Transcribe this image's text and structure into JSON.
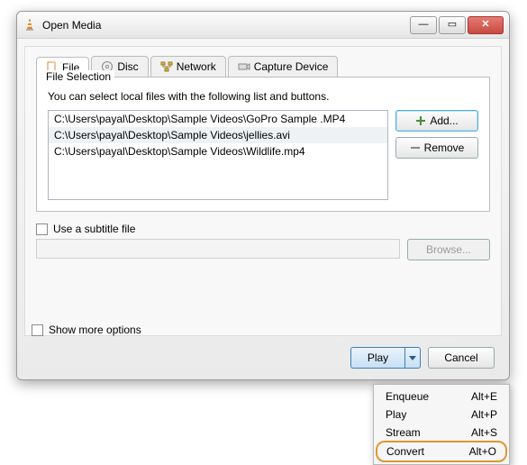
{
  "window": {
    "title": "Open Media"
  },
  "tabs": {
    "file": "File",
    "disc": "Disc",
    "network": "Network",
    "capture": "Capture Device"
  },
  "fileSelection": {
    "legend": "File Selection",
    "hint": "You can select local files with the following list and buttons.",
    "files": [
      "C:\\Users\\payal\\Desktop\\Sample Videos\\GoPro Sample .MP4",
      "C:\\Users\\payal\\Desktop\\Sample Videos\\jellies.avi",
      "C:\\Users\\payal\\Desktop\\Sample Videos\\Wildlife.mp4"
    ],
    "add": "Add...",
    "remove": "Remove"
  },
  "subtitle": {
    "label": "Use a subtitle file",
    "browse": "Browse..."
  },
  "more": "Show more options",
  "footer": {
    "play": "Play",
    "cancel": "Cancel"
  },
  "menu": {
    "items": [
      {
        "label": "Enqueue",
        "shortcut": "Alt+E"
      },
      {
        "label": "Play",
        "shortcut": "Alt+P"
      },
      {
        "label": "Stream",
        "shortcut": "Alt+S"
      },
      {
        "label": "Convert",
        "shortcut": "Alt+O"
      }
    ]
  }
}
